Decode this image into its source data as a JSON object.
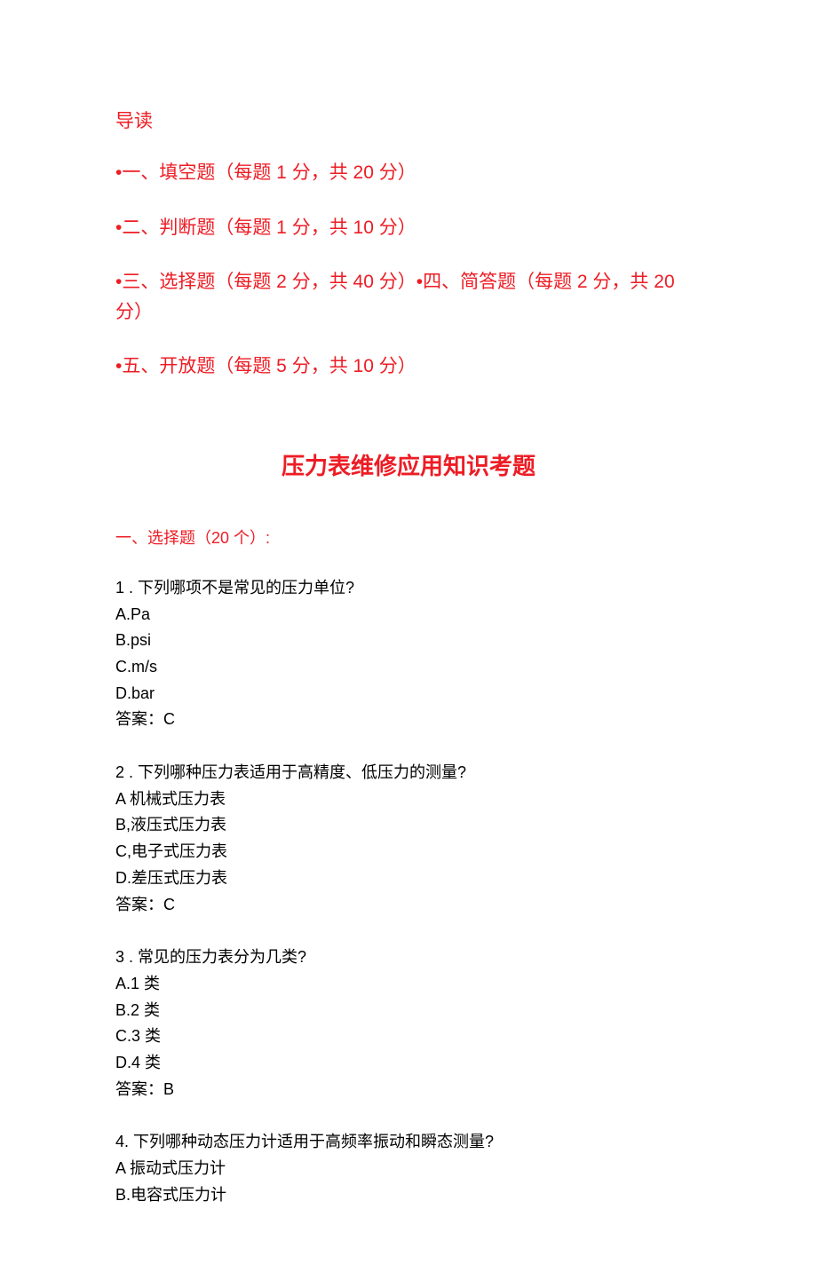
{
  "nav": {
    "heading": "导读",
    "items": [
      "•一、填空题（每题 1 分，共 20 分）",
      " •二、判断题（每题 1 分，共 10 分）",
      " •三、选择题（每题 2 分，共 40 分）•四、简答题（每题 2 分，共 20 分）",
      "•五、开放题（每题 5 分，共 10 分）"
    ]
  },
  "title": "压力表维修应用知识考题",
  "section_heading": "一、选择题（20 个）:",
  "questions": [
    {
      "num": "1",
      "stem": " . 下列哪项不是常见的压力单位?",
      "options": [
        "A.Pa",
        "B.psi",
        "C.m/s",
        "D.bar"
      ],
      "answer": "答案：C"
    },
    {
      "num": "2",
      "stem": " . 下列哪种压力表适用于高精度、低压力的测量?",
      "options": [
        "A 机械式压力表",
        "B,液压式压力表",
        "C,电子式压力表",
        "D.差压式压力表"
      ],
      "answer": "答案：C"
    },
    {
      "num": "3",
      "stem": " . 常见的压力表分为几类?",
      "options": [
        "A.1 类",
        "B.2 类",
        "C.3 类",
        "D.4 类"
      ],
      "answer": "答案：B"
    },
    {
      "num": "4.",
      "stem": " 下列哪种动态压力计适用于高频率振动和瞬态测量?",
      "options": [
        "A 振动式压力计",
        "B.电容式压力计"
      ],
      "answer": ""
    }
  ]
}
